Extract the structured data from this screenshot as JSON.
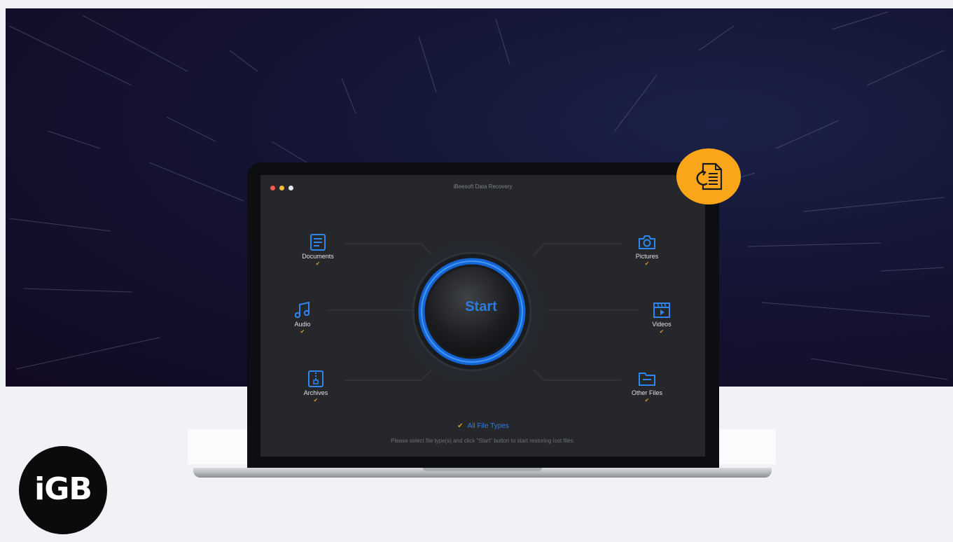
{
  "app": {
    "title": "iBeesoft Data Recovery",
    "start_label": "Start",
    "all_file_types_label": "All File Types",
    "hint_text": "Please select file type(s) and click \"Start\" button to start restoring lost files."
  },
  "categories": [
    {
      "label": "Documents",
      "icon": "document-icon",
      "checked": true
    },
    {
      "label": "Audio",
      "icon": "music-note-icon",
      "checked": true
    },
    {
      "label": "Archives",
      "icon": "archive-zip-icon",
      "checked": true
    },
    {
      "label": "Pictures",
      "icon": "camera-icon",
      "checked": true
    },
    {
      "label": "Videos",
      "icon": "video-clapper-icon",
      "checked": true
    },
    {
      "label": "Other Files",
      "icon": "folder-icon",
      "checked": true
    }
  ],
  "check_glyph": "✔",
  "colors": {
    "accent_blue": "#2a7be6",
    "check_orange": "#d79a2b",
    "badge_orange": "#fba61a"
  },
  "logo": {
    "text": "iGB"
  },
  "badge": {
    "icon": "file-restore-icon"
  }
}
